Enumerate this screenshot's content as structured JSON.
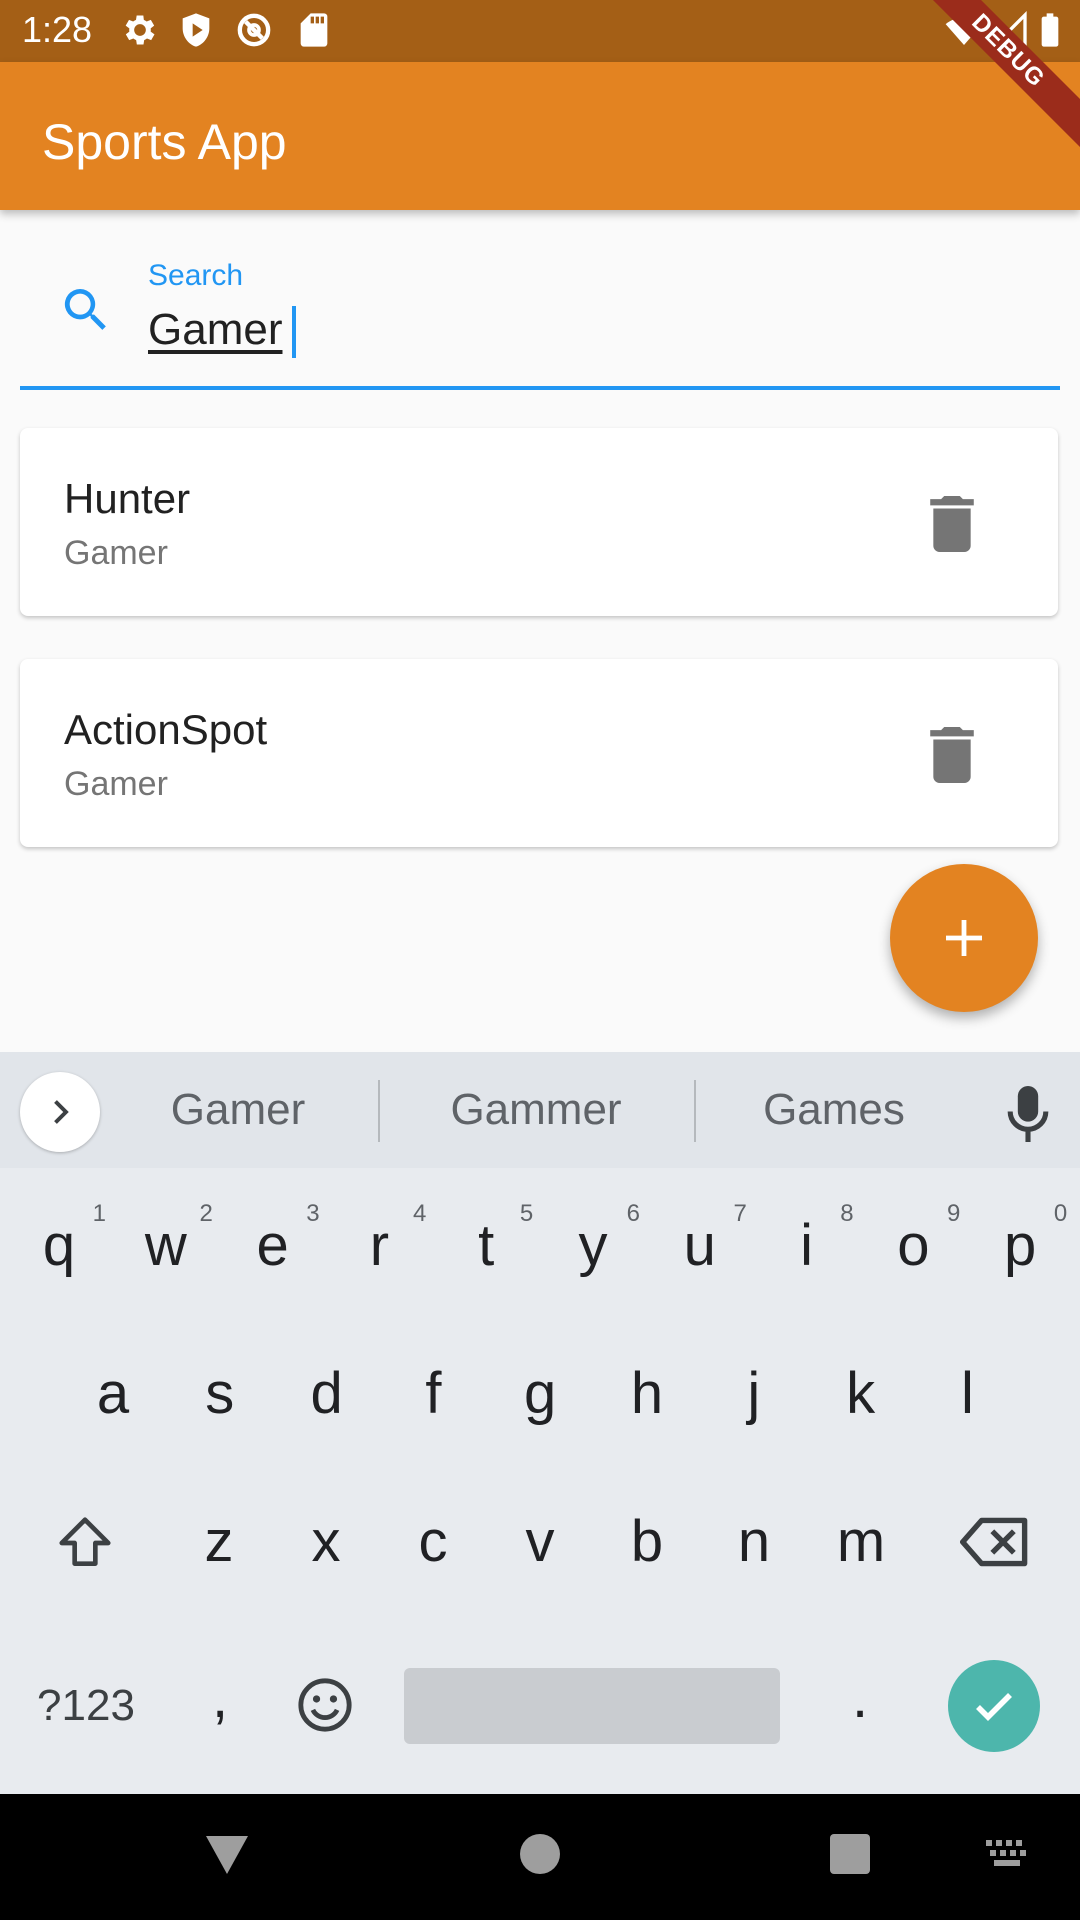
{
  "status_bar": {
    "time": "1:28",
    "icons": [
      "settings-icon",
      "shield-icon",
      "sync-icon",
      "sd-card-icon",
      "wifi-icon",
      "signal-icon",
      "battery-icon"
    ],
    "debug_banner": "DEBUG"
  },
  "app_bar": {
    "title": "Sports App",
    "color": "#e38321"
  },
  "search": {
    "label": "Search",
    "value": "Gamer",
    "accent": "#2196f3"
  },
  "results": [
    {
      "name": "Hunter",
      "role": "Gamer",
      "action_icon": "delete-icon"
    },
    {
      "name": "ActionSpot",
      "role": "Gamer",
      "action_icon": "delete-icon"
    }
  ],
  "fab": {
    "icon": "add-icon"
  },
  "keyboard": {
    "suggestions": [
      "Gamer",
      "Gammer",
      "Games"
    ],
    "row1": [
      "q",
      "w",
      "e",
      "r",
      "t",
      "y",
      "u",
      "i",
      "o",
      "p"
    ],
    "row1_hints": [
      "1",
      "2",
      "3",
      "4",
      "5",
      "6",
      "7",
      "8",
      "9",
      "0"
    ],
    "row2": [
      "a",
      "s",
      "d",
      "f",
      "g",
      "h",
      "j",
      "k",
      "l"
    ],
    "row3": [
      "z",
      "x",
      "c",
      "v",
      "b",
      "n",
      "m"
    ],
    "symbols_label": "?123",
    "comma": ",",
    "period": ".",
    "enter_color": "#4db6ac"
  },
  "nav_bar": {
    "icons": [
      "back-icon",
      "home-icon",
      "recents-icon",
      "keyboard-switch-icon"
    ]
  }
}
